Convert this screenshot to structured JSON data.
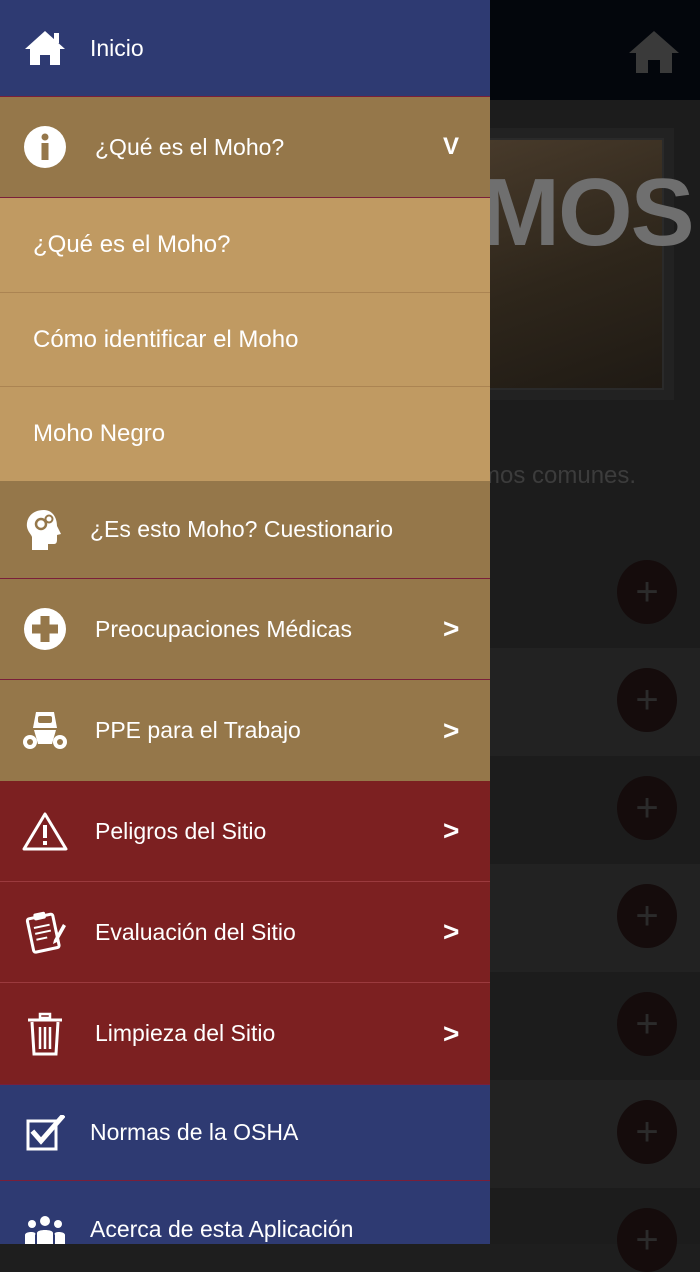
{
  "background": {
    "caption": "mos comunes.",
    "image_text": "MOS",
    "plus_symbol": "+"
  },
  "menu": {
    "inicio": "Inicio",
    "que_es_moho": "¿Qué es el Moho?",
    "submenu": [
      "¿Qué es el Moho?",
      "Cómo identificar el Moho",
      "Moho Negro"
    ],
    "cuestionario": "¿Es esto Moho? Cuestionario",
    "preocupaciones": "Preocupaciones Médicas",
    "ppe": "PPE para el Trabajo",
    "peligros": "Peligros del Sitio",
    "evaluacion": "Evaluación del Sitio",
    "limpieza": "Limpieza del Sitio",
    "osha": "Normas de la OSHA",
    "acerca": "Acerca de esta Aplicación",
    "expand_chevron": "V",
    "arrow": ">"
  },
  "colors": {
    "blue": "#2e3a72",
    "brown": "#95774a",
    "tan": "#c09a62",
    "red": "#7c2021"
  }
}
